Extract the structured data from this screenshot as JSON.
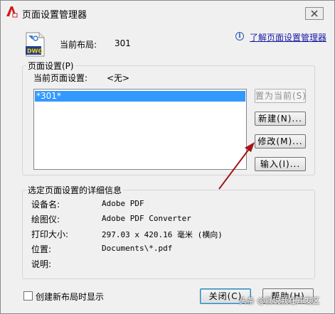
{
  "window": {
    "title": "页面设置管理器"
  },
  "header": {
    "current_layout_label": "当前布局:",
    "current_layout_value": "301",
    "help_link": "了解页面设置管理器",
    "icon_label": "DWG"
  },
  "page_setup": {
    "group_title": "页面设置(P)",
    "current_label": "当前页面设置:",
    "current_value": "<无>",
    "items": [
      "*301*"
    ]
  },
  "buttons": {
    "set_current": "置为当前(S)",
    "new": "新建(N)...",
    "modify": "修改(M)...",
    "import": "输入(I)...",
    "close": "关闭(C)",
    "help": "帮助(H)"
  },
  "details": {
    "group_title": "选定页面设置的详细信息",
    "rows": [
      {
        "label": "设备名:",
        "value": "Adobe PDF"
      },
      {
        "label": "绘图仪:",
        "value": "Adobe PDF Converter"
      },
      {
        "label": "打印大小:",
        "value": "297.03 x 420.16 毫米 (横向)"
      },
      {
        "label": "位置:",
        "value": "Documents\\*.pdf"
      },
      {
        "label": "说明:",
        "value": ""
      }
    ]
  },
  "footer": {
    "checkbox_label": "创建新布局时显示",
    "checkbox_checked": false,
    "watermark": "头条 @就说我在开发区"
  },
  "colors": {
    "selection": "#3399ff",
    "link": "#1a1aa6",
    "annotation_arrow": "#a31515"
  }
}
